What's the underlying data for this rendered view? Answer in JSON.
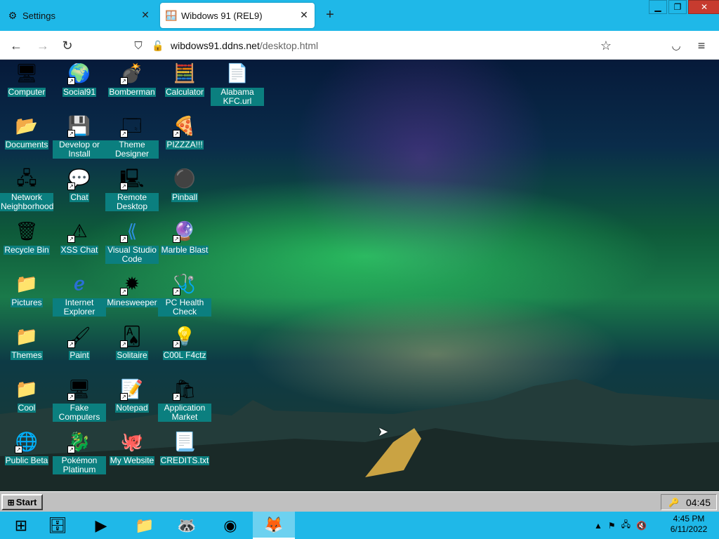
{
  "browser": {
    "tabs": [
      {
        "label": "Settings",
        "icon": "gear-icon"
      },
      {
        "label": "Wibdows 91 (REL9)",
        "icon": "wibdows-favicon"
      }
    ],
    "url_host": "wibdows91.ddns.net",
    "url_path": "/desktop.html"
  },
  "desktop": {
    "icons": [
      {
        "label": "Computer",
        "icon": "computer-icon"
      },
      {
        "label": "Social91",
        "icon": "globe-icon"
      },
      {
        "label": "Bomberman",
        "icon": "bomberman-icon"
      },
      {
        "label": "Calculator",
        "icon": "calculator-icon"
      },
      {
        "label": "Alabama KFC.url",
        "icon": "ie-url-icon"
      },
      {
        "label": "Documents",
        "icon": "folder-docs-icon"
      },
      {
        "label": "Develop or Install",
        "icon": "setup-icon"
      },
      {
        "label": "Theme Designer",
        "icon": "window-icon"
      },
      {
        "label": "PIZZZA!!!",
        "icon": "pizza-icon"
      },
      {
        "label": "Network Neighborhood",
        "icon": "network-icon"
      },
      {
        "label": "Chat",
        "icon": "chat-bubble-icon"
      },
      {
        "label": "Remote Desktop",
        "icon": "remote-desktop-icon"
      },
      {
        "label": "Pinball",
        "icon": "pinball-icon"
      },
      {
        "label": "Recycle Bin",
        "icon": "recycle-bin-icon"
      },
      {
        "label": "XSS Chat",
        "icon": "warning-chat-icon"
      },
      {
        "label": "Visual Studio Code",
        "icon": "vscode-icon"
      },
      {
        "label": "Marble Blast",
        "icon": "marble-icon"
      },
      {
        "label": "Pictures",
        "icon": "folder-icon"
      },
      {
        "label": "Internet Explorer",
        "icon": "ie-icon"
      },
      {
        "label": "Minesweeper",
        "icon": "mine-icon"
      },
      {
        "label": "PC Health Check",
        "icon": "health-check-icon"
      },
      {
        "label": "Themes",
        "icon": "folder-icon"
      },
      {
        "label": "Paint",
        "icon": "paint-icon"
      },
      {
        "label": "Solitaire",
        "icon": "cards-icon"
      },
      {
        "label": "C00L F4ctz",
        "icon": "bulb-icon"
      },
      {
        "label": "Cool",
        "icon": "folder-icon"
      },
      {
        "label": "Fake Computers",
        "icon": "computer-icon"
      },
      {
        "label": "Notepad",
        "icon": "notepad-icon"
      },
      {
        "label": "Application Market",
        "icon": "market-icon"
      },
      {
        "label": "Public Beta",
        "icon": "beta-globe-icon"
      },
      {
        "label": "Pokémon Platinum",
        "icon": "pokemon-icon"
      },
      {
        "label": "My Website",
        "icon": "github-icon"
      },
      {
        "label": "CREDITS.txt",
        "icon": "text-file-icon"
      }
    ]
  },
  "w91_taskbar": {
    "start_label": "Start",
    "time": "04:45"
  },
  "host_taskbar": {
    "time": "4:45 PM",
    "date": "6/11/2022",
    "accent": "#1fb8e8"
  }
}
